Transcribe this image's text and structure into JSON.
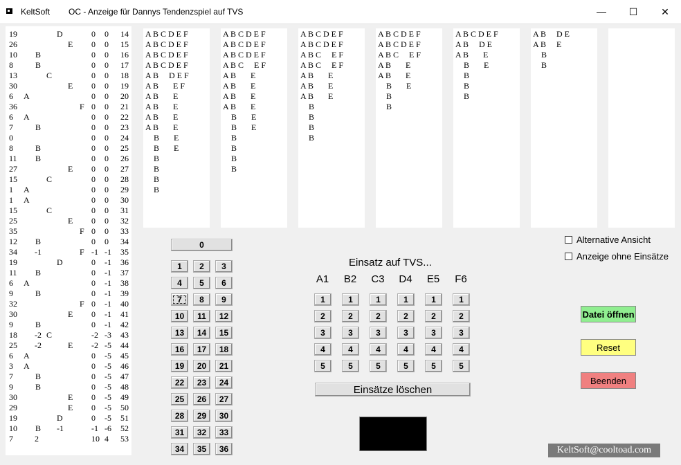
{
  "window": {
    "app_name": "KeltSoft",
    "title": "OC - Anzeige für Dannys Tendenzspiel auf TVS",
    "minimize": "—",
    "maximize": "☐",
    "close": "✕"
  },
  "history": [
    {
      "a": "19",
      "letter": "D",
      "c1": "0",
      "c2": "0",
      "n": "14"
    },
    {
      "a": "26",
      "letter": "E",
      "c1": "0",
      "c2": "0",
      "n": "15"
    },
    {
      "a": "10",
      "letter": "B",
      "c1": "0",
      "c2": "0",
      "n": "16"
    },
    {
      "a": "8",
      "letter": "B",
      "c1": "0",
      "c2": "0",
      "n": "17"
    },
    {
      "a": "13",
      "letter": "C",
      "c1": "0",
      "c2": "0",
      "n": "18"
    },
    {
      "a": "30",
      "letter": "E",
      "c1": "0",
      "c2": "0",
      "n": "19"
    },
    {
      "a": "6",
      "letter": "A",
      "c1": "0",
      "c2": "0",
      "n": "20"
    },
    {
      "a": "36",
      "letter": "F",
      "c1": "0",
      "c2": "0",
      "n": "21"
    },
    {
      "a": "6",
      "letter": "A",
      "c1": "0",
      "c2": "0",
      "n": "22"
    },
    {
      "a": "7",
      "letter": "B",
      "c1": "0",
      "c2": "0",
      "n": "23"
    },
    {
      "a": "0",
      "letter": "",
      "c1": "0",
      "c2": "0",
      "n": "24"
    },
    {
      "a": "8",
      "letter": "B",
      "c1": "0",
      "c2": "0",
      "n": "25"
    },
    {
      "a": "11",
      "letter": "B",
      "c1": "0",
      "c2": "0",
      "n": "26"
    },
    {
      "a": "27",
      "letter": "E",
      "c1": "0",
      "c2": "0",
      "n": "27"
    },
    {
      "a": "15",
      "letter": "C",
      "c1": "0",
      "c2": "0",
      "n": "28"
    },
    {
      "a": "1",
      "letter": "A",
      "c1": "0",
      "c2": "0",
      "n": "29"
    },
    {
      "a": "1",
      "letter": "A",
      "c1": "0",
      "c2": "0",
      "n": "30"
    },
    {
      "a": "15",
      "letter": "C",
      "c1": "0",
      "c2": "0",
      "n": "31"
    },
    {
      "a": "25",
      "letter": "E",
      "c1": "0",
      "c2": "0",
      "n": "32"
    },
    {
      "a": "35",
      "letter": "F",
      "c1": "0",
      "c2": "0",
      "n": "33"
    },
    {
      "a": "12",
      "letter": "B",
      "c1": "0",
      "c2": "0",
      "n": "34"
    },
    {
      "a": "34",
      "x": "-1",
      "letter": "F",
      "c1": "-1",
      "c2": "-1",
      "n": "35"
    },
    {
      "a": "19",
      "letter": "D",
      "c1": "0",
      "c2": "-1",
      "n": "36"
    },
    {
      "a": "11",
      "letter": "B",
      "c1": "0",
      "c2": "-1",
      "n": "37"
    },
    {
      "a": "6",
      "letter": "A",
      "c1": "0",
      "c2": "-1",
      "n": "38"
    },
    {
      "a": "9",
      "letter": "B",
      "c1": "0",
      "c2": "-1",
      "n": "39"
    },
    {
      "a": "32",
      "letter": "F",
      "c1": "0",
      "c2": "-1",
      "n": "40"
    },
    {
      "a": "30",
      "letter": "E",
      "c1": "0",
      "c2": "-1",
      "n": "41"
    },
    {
      "a": "9",
      "letter": "B",
      "c1": "0",
      "c2": "-1",
      "n": "42"
    },
    {
      "a": "18",
      "x": "-2",
      "letter": "C",
      "c1": "-2",
      "c2": "-3",
      "n": "43"
    },
    {
      "a": "25",
      "x": "-2",
      "letter": "E",
      "c1": "-2",
      "c2": "-5",
      "n": "44"
    },
    {
      "a": "6",
      "letter": "A",
      "c1": "0",
      "c2": "-5",
      "n": "45"
    },
    {
      "a": "3",
      "letter": "A",
      "c1": "0",
      "c2": "-5",
      "n": "46"
    },
    {
      "a": "7",
      "letter": "B",
      "c1": "0",
      "c2": "-5",
      "n": "47"
    },
    {
      "a": "9",
      "letter": "B",
      "c1": "0",
      "c2": "-5",
      "n": "48"
    },
    {
      "a": "30",
      "letter": "E",
      "c1": "0",
      "c2": "-5",
      "n": "49"
    },
    {
      "a": "29",
      "letter": "E",
      "c1": "0",
      "c2": "-5",
      "n": "50"
    },
    {
      "a": "19",
      "letter": "D",
      "c1": "0",
      "c2": "-5",
      "n": "51"
    },
    {
      "a": "10",
      "letter": "B",
      "x": "-1",
      "c1": "-1",
      "c2": "-6",
      "n": "52"
    },
    {
      "a": "7",
      "x": "2",
      "letter": "",
      "c1": "10",
      "c2": "4",
      "n": "53"
    }
  ],
  "columns": [
    [
      "A B C D E F",
      "A B C D E F",
      "A B C D E F",
      "A B C D E F",
      "A B     D E F",
      "A B       E F",
      "A B       E",
      "A B       E",
      "A B       E",
      "A B       E",
      "    B       E",
      "    B       E",
      "    B",
      "    B",
      "    B",
      "    B"
    ],
    [
      "A B C D E F",
      "A B C D E F",
      "A B C D E F",
      "A B C     E F",
      "A B       E",
      "A B       E",
      "A B       E",
      "A B       E",
      "    B       E",
      "    B       E",
      "    B",
      "    B",
      "    B",
      "    B"
    ],
    [
      "A B C D E F",
      "A B C D E F",
      "A B C     E F",
      "A B C     E F",
      "A B       E",
      "A B       E",
      "A B       E",
      "    B",
      "    B",
      "    B",
      "    B"
    ],
    [
      "A B C D E F",
      "A B C D E F",
      "A B C     E F",
      "A B       E",
      "A B       E",
      "    B       E",
      "    B",
      "    B"
    ],
    [
      "A B C D E F",
      "A B     D E",
      "A B       E",
      "    B       E",
      "    B",
      "    B",
      "    B"
    ],
    [
      "A B     D E",
      "A B     E",
      "    B",
      "    B"
    ],
    []
  ],
  "keypad": {
    "zero": "0",
    "numbers": [
      "1",
      "2",
      "3",
      "4",
      "5",
      "6",
      "7",
      "8",
      "9",
      "10",
      "11",
      "12",
      "13",
      "14",
      "15",
      "16",
      "17",
      "18",
      "19",
      "20",
      "21",
      "22",
      "23",
      "24",
      "25",
      "26",
      "27",
      "28",
      "29",
      "30",
      "31",
      "32",
      "33",
      "34",
      "35",
      "36"
    ]
  },
  "bet_panel": {
    "heading": "Einsatz auf TVS...",
    "columns": [
      "A1",
      "B2",
      "C3",
      "D4",
      "E5",
      "F6"
    ],
    "amounts": [
      "1",
      "2",
      "3",
      "4",
      "5"
    ],
    "clear_label": "Einsätze löschen"
  },
  "options": {
    "alt_view": "Alternative Ansicht",
    "no_bets_view": "Anzeige ohne Einsätze"
  },
  "actions": {
    "open_file": "Datei öffnen",
    "reset": "Reset",
    "quit": "Beenden"
  },
  "footer": "KeltSoft@cooltoad.com",
  "colors": {
    "open_file": "#90ee90",
    "reset": "#ffff80",
    "quit": "#f08080"
  }
}
